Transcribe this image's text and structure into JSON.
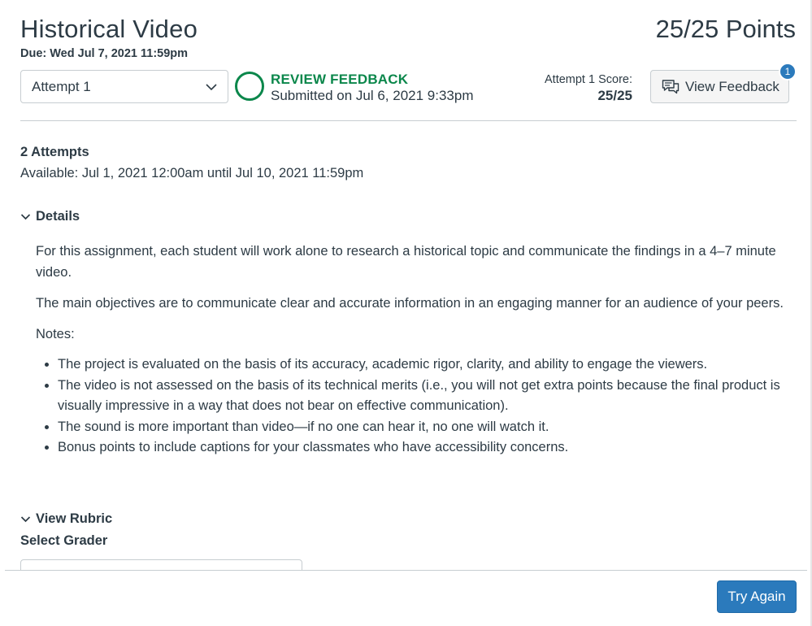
{
  "assignment": {
    "title": "Historical Video",
    "points_value": "25/25",
    "points_label": "Points",
    "due": "Due: Wed Jul 7, 2021 11:59pm"
  },
  "attempt_select": {
    "value": "Attempt 1"
  },
  "status": {
    "title": "REVIEW FEEDBACK",
    "submitted": "Submitted on Jul 6, 2021 9:33pm",
    "color": "#0b874b"
  },
  "score": {
    "label": "Attempt 1 Score:",
    "value": "25/25"
  },
  "feedback_button": {
    "label": "View Feedback",
    "badge_count": "1",
    "icon": "comment-icon"
  },
  "attempts_info": {
    "count": "2 Attempts",
    "available": "Available: Jul 1, 2021 12:00am until Jul 10, 2021 11:59pm"
  },
  "details": {
    "toggle_label": "Details",
    "paragraphs": [
      "For this assignment, each student will work alone to research a historical topic and communicate the findings in a 4–7 minute video.",
      "The main objectives are to communicate clear and accurate information in an engaging manner for an audience of your peers.",
      "Notes:"
    ],
    "bullets": [
      "The project is evaluated on the basis of its accuracy, academic rigor, clarity, and ability to engage the viewers.",
      "The video is not assessed on the basis of its technical merits (i.e., you will not get extra points because the final product is visually impressive in a way that does not bear on effective communication).",
      "The sound is more important than video—if no one can hear it, no one will watch it.",
      "Bonus points to include captions for your classmates who have accessibility concerns."
    ]
  },
  "rubric": {
    "toggle_label": "View Rubric",
    "grader_label": "Select Grader"
  },
  "footer": {
    "try_again_label": "Try Again"
  },
  "colors": {
    "accent": "#2b7abc",
    "success": "#0b874b",
    "text": "#2d3b45",
    "border": "#c7cdd1"
  }
}
